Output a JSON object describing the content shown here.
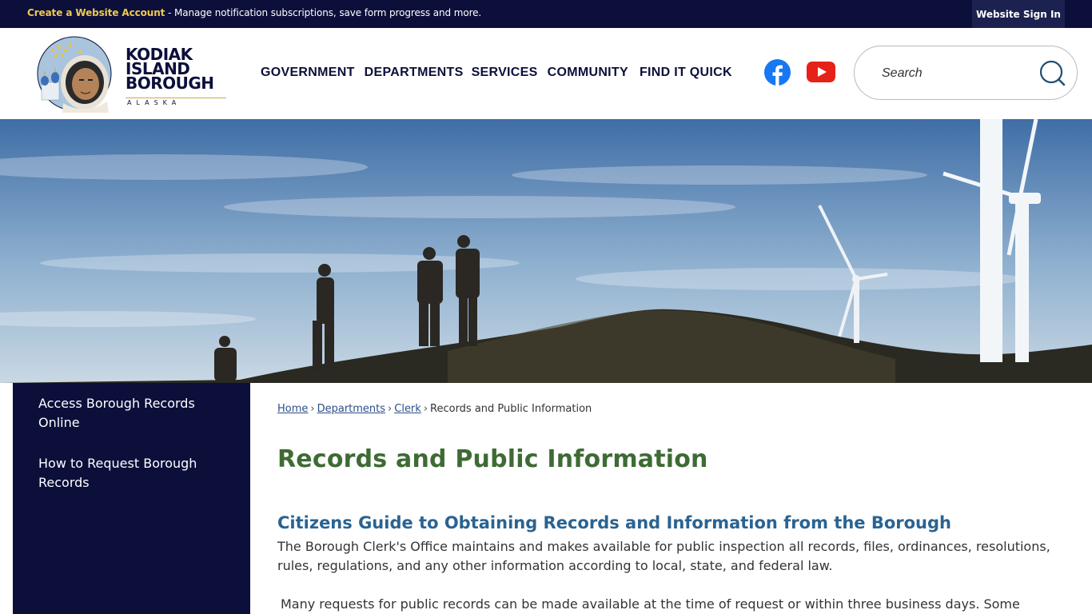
{
  "topbar": {
    "account_link": "Create a Website Account",
    "account_message": " - Manage notification subscriptions, save form progress and more.",
    "sign_in": "Website Sign In"
  },
  "logo": {
    "line1": "KODIAK",
    "line2": "ISLAND",
    "line3": "BOROUGH",
    "subline": "ALASKA"
  },
  "nav": {
    "items": [
      "GOVERNMENT",
      "DEPARTMENTS",
      "SERVICES",
      "COMMUNITY",
      "FIND IT QUICK"
    ]
  },
  "social": {
    "facebook_icon": "facebook-icon",
    "youtube_icon": "youtube-icon"
  },
  "search": {
    "placeholder": "Search",
    "icon": "search-icon"
  },
  "sidebar": {
    "items": [
      {
        "label": "Access Borough Records Online"
      },
      {
        "label": "How to Request Borough Records"
      }
    ]
  },
  "breadcrumb": {
    "home": "Home",
    "departments": "Departments",
    "clerk": "Clerk",
    "separator": "›",
    "current": "Records and Public Information"
  },
  "content": {
    "title": "Records and Public Information",
    "subtitle": "Citizens Guide to Obtaining Records and Information from the Borough",
    "paragraph1": "The Borough Clerk's Office maintains and makes available for public inspection all records, files, ordinances, resolutions, rules, regulations, and any other information according to local, state, and federal law.",
    "paragraph2": "Many requests for public records can be made available at the time of request or within three business days. Some"
  },
  "colors": {
    "navy": "#0b0f3a",
    "gold_link": "#f2c94c",
    "title_green": "#3e6b34",
    "subtitle_blue": "#2a6391",
    "facebook_blue": "#1877f2",
    "youtube_red": "#e62117"
  }
}
